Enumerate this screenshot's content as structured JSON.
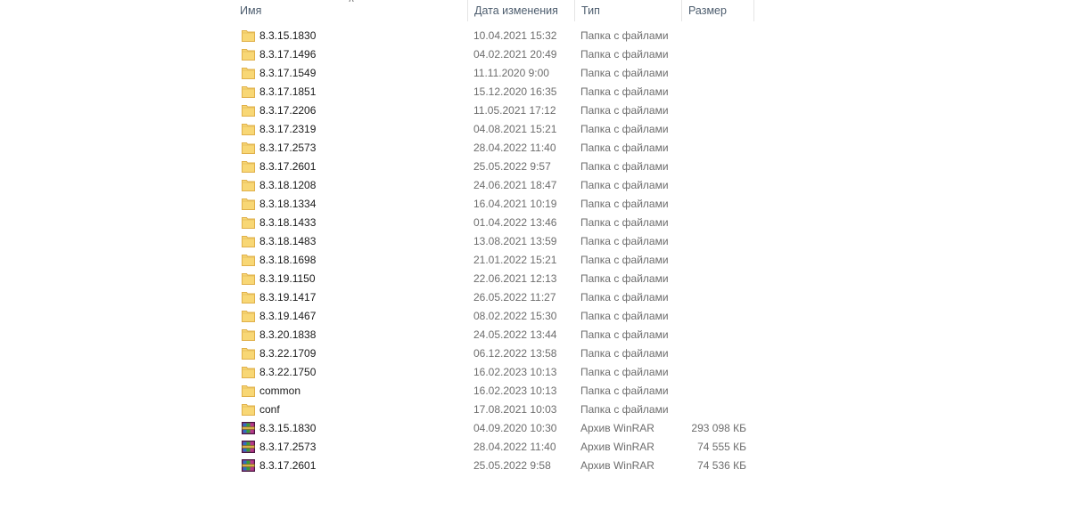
{
  "columns": {
    "name": "Имя",
    "date": "Дата изменения",
    "type": "Тип",
    "size": "Размер"
  },
  "files": [
    {
      "name": "8.3.15.1830",
      "date": "10.04.2021 15:32",
      "type": "Папка с файлами",
      "size": "",
      "icon": "folder-icon"
    },
    {
      "name": "8.3.17.1496",
      "date": "04.02.2021 20:49",
      "type": "Папка с файлами",
      "size": "",
      "icon": "folder-icon"
    },
    {
      "name": "8.3.17.1549",
      "date": "11.11.2020 9:00",
      "type": "Папка с файлами",
      "size": "",
      "icon": "folder-icon"
    },
    {
      "name": "8.3.17.1851",
      "date": "15.12.2020 16:35",
      "type": "Папка с файлами",
      "size": "",
      "icon": "folder-icon"
    },
    {
      "name": "8.3.17.2206",
      "date": "11.05.2021 17:12",
      "type": "Папка с файлами",
      "size": "",
      "icon": "folder-icon"
    },
    {
      "name": "8.3.17.2319",
      "date": "04.08.2021 15:21",
      "type": "Папка с файлами",
      "size": "",
      "icon": "folder-icon"
    },
    {
      "name": "8.3.17.2573",
      "date": "28.04.2022 11:40",
      "type": "Папка с файлами",
      "size": "",
      "icon": "folder-icon"
    },
    {
      "name": "8.3.17.2601",
      "date": "25.05.2022 9:57",
      "type": "Папка с файлами",
      "size": "",
      "icon": "folder-icon"
    },
    {
      "name": "8.3.18.1208",
      "date": "24.06.2021 18:47",
      "type": "Папка с файлами",
      "size": "",
      "icon": "folder-icon"
    },
    {
      "name": "8.3.18.1334",
      "date": "16.04.2021 10:19",
      "type": "Папка с файлами",
      "size": "",
      "icon": "folder-icon"
    },
    {
      "name": "8.3.18.1433",
      "date": "01.04.2022 13:46",
      "type": "Папка с файлами",
      "size": "",
      "icon": "folder-icon"
    },
    {
      "name": "8.3.18.1483",
      "date": "13.08.2021 13:59",
      "type": "Папка с файлами",
      "size": "",
      "icon": "folder-icon"
    },
    {
      "name": "8.3.18.1698",
      "date": "21.01.2022 15:21",
      "type": "Папка с файлами",
      "size": "",
      "icon": "folder-icon"
    },
    {
      "name": "8.3.19.1150",
      "date": "22.06.2021 12:13",
      "type": "Папка с файлами",
      "size": "",
      "icon": "folder-icon"
    },
    {
      "name": "8.3.19.1417",
      "date": "26.05.2022 11:27",
      "type": "Папка с файлами",
      "size": "",
      "icon": "folder-icon"
    },
    {
      "name": "8.3.19.1467",
      "date": "08.02.2022 15:30",
      "type": "Папка с файлами",
      "size": "",
      "icon": "folder-icon"
    },
    {
      "name": "8.3.20.1838",
      "date": "24.05.2022 13:44",
      "type": "Папка с файлами",
      "size": "",
      "icon": "folder-icon"
    },
    {
      "name": "8.3.22.1709",
      "date": "06.12.2022 13:58",
      "type": "Папка с файлами",
      "size": "",
      "icon": "folder-icon"
    },
    {
      "name": "8.3.22.1750",
      "date": "16.02.2023 10:13",
      "type": "Папка с файлами",
      "size": "",
      "icon": "folder-icon"
    },
    {
      "name": "common",
      "date": "16.02.2023 10:13",
      "type": "Папка с файлами",
      "size": "",
      "icon": "folder-icon"
    },
    {
      "name": "conf",
      "date": "17.08.2021 10:03",
      "type": "Папка с файлами",
      "size": "",
      "icon": "folder-icon"
    },
    {
      "name": "8.3.15.1830",
      "date": "04.09.2020 10:30",
      "type": "Архив WinRAR",
      "size": "293 098 КБ",
      "icon": "winrar-archive-icon"
    },
    {
      "name": "8.3.17.2573",
      "date": "28.04.2022 11:40",
      "type": "Архив WinRAR",
      "size": "74 555 КБ",
      "icon": "winrar-archive-icon"
    },
    {
      "name": "8.3.17.2601",
      "date": "25.05.2022 9:58",
      "type": "Архив WinRAR",
      "size": "74 536 КБ",
      "icon": "winrar-archive-icon"
    }
  ],
  "icons": {
    "sort": "chevron-up-icon"
  },
  "colors": {
    "folder": "#f8d775",
    "folder_dark": "#e8b84a",
    "header_text": "#4d5d6e",
    "secondary_text": "#6d6d6d"
  }
}
